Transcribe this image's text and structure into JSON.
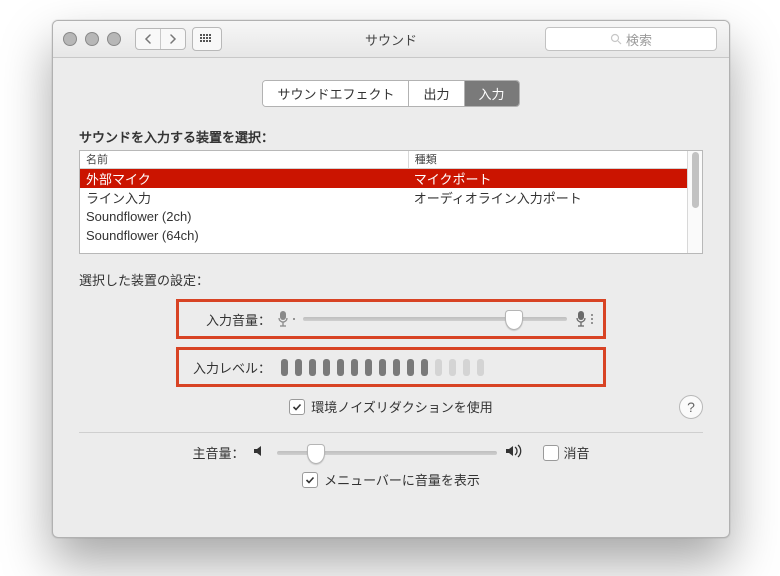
{
  "window": {
    "title": "サウンド"
  },
  "search": {
    "placeholder": "検索"
  },
  "tabs": {
    "t0": "サウンドエフェクト",
    "t1": "出力",
    "t2": "入力"
  },
  "section_select_label": "サウンドを入力する装置を選択：",
  "table": {
    "col_name": "名前",
    "col_type": "種類",
    "rows": [
      {
        "name": "外部マイク",
        "type": "マイクポート",
        "selected": true
      },
      {
        "name": "ライン入力",
        "type": "オーディオライン入力ポート",
        "selected": false
      },
      {
        "name": "Soundflower (2ch)",
        "type": "",
        "selected": false
      },
      {
        "name": "Soundflower (64ch)",
        "type": "",
        "selected": false
      }
    ]
  },
  "selected_settings_label": "選択した装置の設定：",
  "input_volume_label": "入力音量：",
  "input_volume_percent": 80,
  "input_level_label": "入力レベル：",
  "input_level_active_segments": 11,
  "input_level_total_segments": 15,
  "noise_reduction_label": "環境ノイズリダクションを使用",
  "noise_reduction_checked": true,
  "master_volume_label": "主音量：",
  "master_volume_percent": 18,
  "mute_label": "消音",
  "mute_checked": false,
  "menubar_label": "メニューバーに音量を表示",
  "menubar_checked": true
}
